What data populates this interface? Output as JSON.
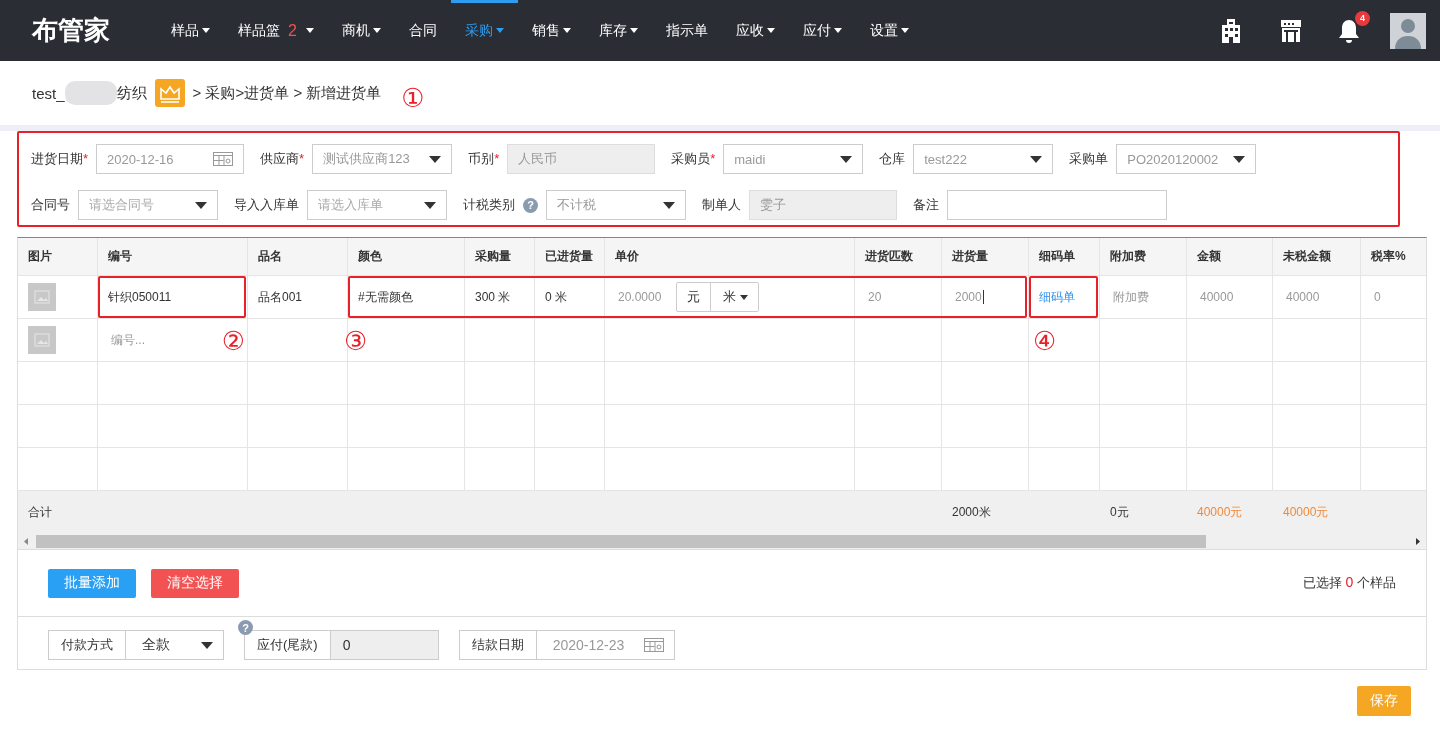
{
  "nav": {
    "logo": "布管家",
    "items": [
      {
        "label": "样品",
        "selected": false,
        "has_menu": true
      },
      {
        "label": "样品篮",
        "selected": false,
        "has_menu": true,
        "count": "2"
      },
      {
        "label": "商机",
        "selected": false,
        "has_menu": true
      },
      {
        "label": "合同",
        "selected": false,
        "has_menu": false
      },
      {
        "label": "采购",
        "selected": true,
        "has_menu": true
      },
      {
        "label": "销售",
        "selected": false,
        "has_menu": true
      },
      {
        "label": "库存",
        "selected": false,
        "has_menu": true
      },
      {
        "label": "指示单",
        "selected": false,
        "has_menu": false
      },
      {
        "label": "应收",
        "selected": false,
        "has_menu": true
      },
      {
        "label": "应付",
        "selected": false,
        "has_menu": true
      },
      {
        "label": "设置",
        "selected": false,
        "has_menu": true
      }
    ],
    "notification_count": "4"
  },
  "breadcrumb": {
    "company_prefix": "test_",
    "company_suffix": "纺织",
    "path": "> 采购>进货单 > 新增进货单",
    "annotation": "①"
  },
  "form": {
    "highlighted": true,
    "rows": [
      [
        {
          "label": "进货日期",
          "required_mark": "*",
          "kind": "date",
          "value": "2020-12-16"
        },
        {
          "label": "供应商",
          "required_mark": "*",
          "kind": "select",
          "value": "测试供应商123"
        },
        {
          "label": "币别",
          "required_mark": "*",
          "kind": "readonly",
          "value": "人民币"
        },
        {
          "label": "采购员",
          "required_mark": "*",
          "kind": "select",
          "value": "maidi"
        },
        {
          "label": "仓库",
          "kind": "select",
          "value": "test222"
        },
        {
          "label": "采购单",
          "kind": "select",
          "value": "PO2020120002"
        }
      ],
      [
        {
          "label": "合同号",
          "kind": "select",
          "placeholder": "请选合同号"
        },
        {
          "label": "导入入库单",
          "kind": "select",
          "placeholder": "请选入库单"
        },
        {
          "label": "计税类别",
          "help": "?",
          "kind": "select",
          "value": "不计税"
        },
        {
          "label": "制单人",
          "kind": "readonly",
          "value": "雯子"
        },
        {
          "label": "备注",
          "kind": "text"
        }
      ]
    ]
  },
  "table": {
    "columns": [
      {
        "label": "图片"
      },
      {
        "label": "编号"
      },
      {
        "label": "品名"
      },
      {
        "label": "颜色"
      },
      {
        "label": "采购量"
      },
      {
        "label": "已进货量"
      },
      {
        "label": "单价"
      },
      {
        "label": "进货匹数"
      },
      {
        "label": "进货量",
        "total": "2000米",
        "emphasis": false
      },
      {
        "label": "细码单"
      },
      {
        "label": "附加费",
        "total": "0元",
        "emphasis": false
      },
      {
        "label": "金额",
        "total": "40000元",
        "emphasis": true
      },
      {
        "label": "未税金额",
        "total": "40000元",
        "emphasis": true
      },
      {
        "label": "税率%"
      }
    ],
    "total_label": "合计",
    "rows": [
      {
        "groups": [
          {
            "framed": false,
            "cells": [
              {
                "kind": "image"
              }
            ]
          },
          {
            "framed": true,
            "cells": [
              {
                "kind": "text",
                "text": "针织050011"
              }
            ]
          },
          {
            "framed": false,
            "cells": [
              {
                "kind": "text",
                "text": "品名001"
              }
            ]
          },
          {
            "framed": true,
            "cells": [
              {
                "kind": "text",
                "text": "#无需颜色"
              },
              {
                "kind": "text",
                "text": "300 米"
              },
              {
                "kind": "text",
                "text": "0 米"
              },
              {
                "kind": "price",
                "text": "20.0000",
                "currency": "元",
                "unit": "米"
              },
              {
                "kind": "input",
                "text": "20"
              },
              {
                "kind": "input",
                "text": "2000",
                "focused": true
              }
            ]
          },
          {
            "framed": true,
            "cells": [
              {
                "kind": "link",
                "text": "细码单"
              }
            ]
          },
          {
            "framed": false,
            "cells": [
              {
                "kind": "placeholder",
                "text": "附加费"
              },
              {
                "kind": "input",
                "text": "40000"
              },
              {
                "kind": "input",
                "text": "40000"
              },
              {
                "kind": "input",
                "text": "0"
              }
            ]
          }
        ]
      },
      {
        "cells": [
          {
            "kind": "image"
          },
          {
            "kind": "placeholder",
            "text": "编号...",
            "annotation": "②"
          },
          {
            "kind": "empty"
          },
          {
            "kind": "empty",
            "annotation": "③"
          },
          {
            "kind": "empty"
          },
          {
            "kind": "empty"
          },
          {
            "kind": "empty"
          },
          {
            "kind": "empty"
          },
          {
            "kind": "empty"
          },
          {
            "kind": "empty",
            "annotation": "④"
          },
          {
            "kind": "empty"
          },
          {
            "kind": "empty"
          },
          {
            "kind": "empty"
          },
          {
            "kind": "empty"
          }
        ]
      }
    ]
  },
  "actions": [
    {
      "label": "批量添加",
      "kind": "primary"
    },
    {
      "label": "清空选择",
      "kind": "danger"
    }
  ],
  "selection": {
    "prefix": "已选择",
    "count": "0",
    "suffix": "个样品"
  },
  "payment": [
    {
      "label": "付款方式",
      "kind": "select",
      "value": "全款"
    },
    {
      "label": "应付(尾款)",
      "kind": "readonly",
      "value": "0",
      "help": "?"
    },
    {
      "label": "结款日期",
      "kind": "date",
      "value": "2020-12-23"
    }
  ],
  "save": "保存"
}
